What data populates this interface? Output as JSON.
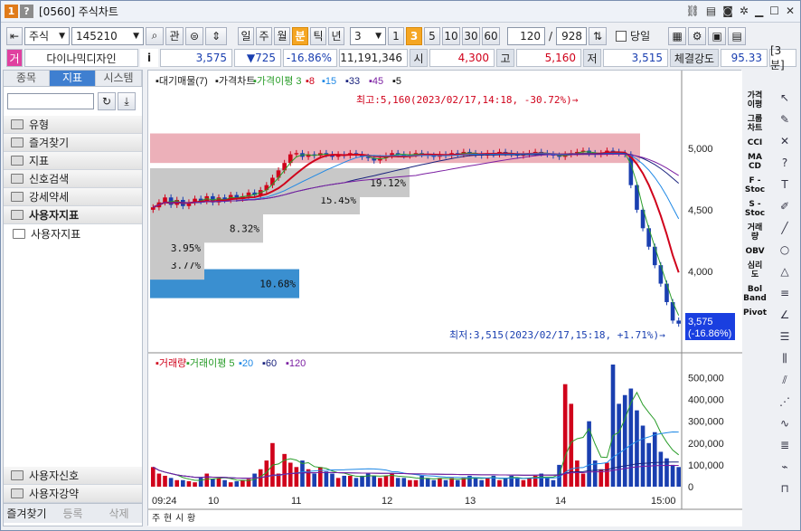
{
  "window": {
    "badge1": "1",
    "badge2": "?",
    "title": "[0560] 주식차트"
  },
  "toolbar": {
    "market": "주식",
    "code": "145210",
    "btn_search_label": "관",
    "periods": [
      "일",
      "주",
      "월",
      "분",
      "틱",
      "년"
    ],
    "active_period": "분",
    "interval": "3",
    "minute_buttons": [
      "1",
      "3",
      "5",
      "10",
      "30",
      "60"
    ],
    "active_minute": "3",
    "count": "120",
    "total": "928",
    "today_label": "당일"
  },
  "info": {
    "flag": "거",
    "name": "다이나믹디자인",
    "info_icon": "i",
    "price": "3,575",
    "change": "▼725",
    "rate": "-16.86%",
    "volume": "11,191,346",
    "open_label": "시",
    "open": "4,300",
    "high_label": "고",
    "high": "5,160",
    "low_label": "저",
    "low": "3,515",
    "strength_label": "체결강도",
    "strength": "95.33",
    "unit": "[3분]"
  },
  "sidebar": {
    "tabs": [
      "종목",
      "지표",
      "시스템"
    ],
    "active_tab": "지표",
    "items": [
      "유형",
      "즐겨찾기",
      "지표",
      "신호검색",
      "강세약세",
      "사용자지표"
    ],
    "sub_item": "사용자지표",
    "bottom_items": [
      "사용자신호",
      "사용자강약"
    ],
    "footer": [
      "즐겨찾기",
      "등록",
      "삭제"
    ]
  },
  "chart_data": [
    {
      "type": "line",
      "legend": [
        "대기매물(7)",
        "가격차트",
        "가격이평 3",
        "8",
        "15",
        "33",
        "45",
        "5"
      ],
      "y_ticks": [
        "5,000",
        "4,500",
        "4,000"
      ],
      "annotations": {
        "high": "최고:5,160(2023/02/17,14:18, -30.72%)→",
        "low": "최저:3,515(2023/02/17,15:18, +1.71%)→"
      },
      "price_tag": [
        "3,575",
        "(-16.86%)"
      ],
      "volume_profile": [
        {
          "label": "10.68%",
          "price": 3900
        },
        {
          "label": "3.77%",
          "price": 4050
        },
        {
          "label": "3.95%",
          "price": 4190
        },
        {
          "label": "8.32%",
          "price": 4350
        },
        {
          "label": "15.45%",
          "price": 4580
        },
        {
          "label": "19.12%",
          "price": 4720
        }
      ],
      "closes": [
        4520,
        4560,
        4600,
        4540,
        4580,
        4530,
        4560,
        4590,
        4570,
        4610,
        4560,
        4600,
        4580,
        4620,
        4590,
        4610,
        4640,
        4620,
        4660,
        4700,
        4760,
        4820,
        4880,
        4950,
        4960,
        4930,
        4950,
        4940,
        4960,
        4950,
        4930,
        4950,
        4940,
        4960,
        4950,
        4930,
        4920,
        4900,
        4920,
        4940,
        4960,
        4950,
        4940,
        4950,
        4960,
        4950,
        4940,
        4930,
        4950,
        4940,
        4960,
        4950,
        4970,
        4960,
        4950,
        4940,
        4960,
        4950,
        4970,
        4960,
        4950,
        4940,
        4950,
        4960,
        4970,
        4960,
        4950,
        4940,
        4930,
        4950,
        4960,
        4970,
        4980,
        4960,
        4950,
        4960,
        4980,
        4970,
        4960,
        4950,
        4700,
        4500,
        4350,
        4200,
        4050,
        3900,
        3750,
        3600,
        3575
      ],
      "ylim": [
        3500,
        5300
      ]
    },
    {
      "type": "bar",
      "legend": [
        "거래량",
        "거래이평 5",
        "20",
        "60",
        "120"
      ],
      "y_ticks": [
        "500,000",
        "400,000",
        "300,000",
        "200,000",
        "100,000",
        "0"
      ],
      "x_ticks": [
        "09:24",
        "10",
        "11",
        "12",
        "13",
        "14",
        "15:00"
      ],
      "values": [
        90000,
        60000,
        50000,
        40000,
        30000,
        30000,
        25000,
        20000,
        40000,
        60000,
        35000,
        40000,
        30000,
        20000,
        25000,
        30000,
        35000,
        60000,
        80000,
        120000,
        200000,
        60000,
        150000,
        110000,
        90000,
        120000,
        80000,
        60000,
        90000,
        70000,
        60000,
        40000,
        50000,
        50000,
        40000,
        50000,
        60000,
        50000,
        40000,
        50000,
        60000,
        40000,
        40000,
        30000,
        30000,
        50000,
        40000,
        30000,
        40000,
        30000,
        40000,
        30000,
        40000,
        50000,
        40000,
        30000,
        40000,
        50000,
        30000,
        40000,
        50000,
        40000,
        30000,
        40000,
        50000,
        60000,
        40000,
        30000,
        100000,
        470000,
        380000,
        120000,
        60000,
        300000,
        120000,
        80000,
        110000,
        560000,
        380000,
        420000,
        450000,
        350000,
        280000,
        200000,
        250000,
        160000,
        130000,
        100000,
        90000
      ],
      "ylim": [
        0,
        560000
      ]
    }
  ],
  "bottom_bar": {
    "tabs": [
      "주",
      "현",
      "시",
      "황"
    ]
  }
}
